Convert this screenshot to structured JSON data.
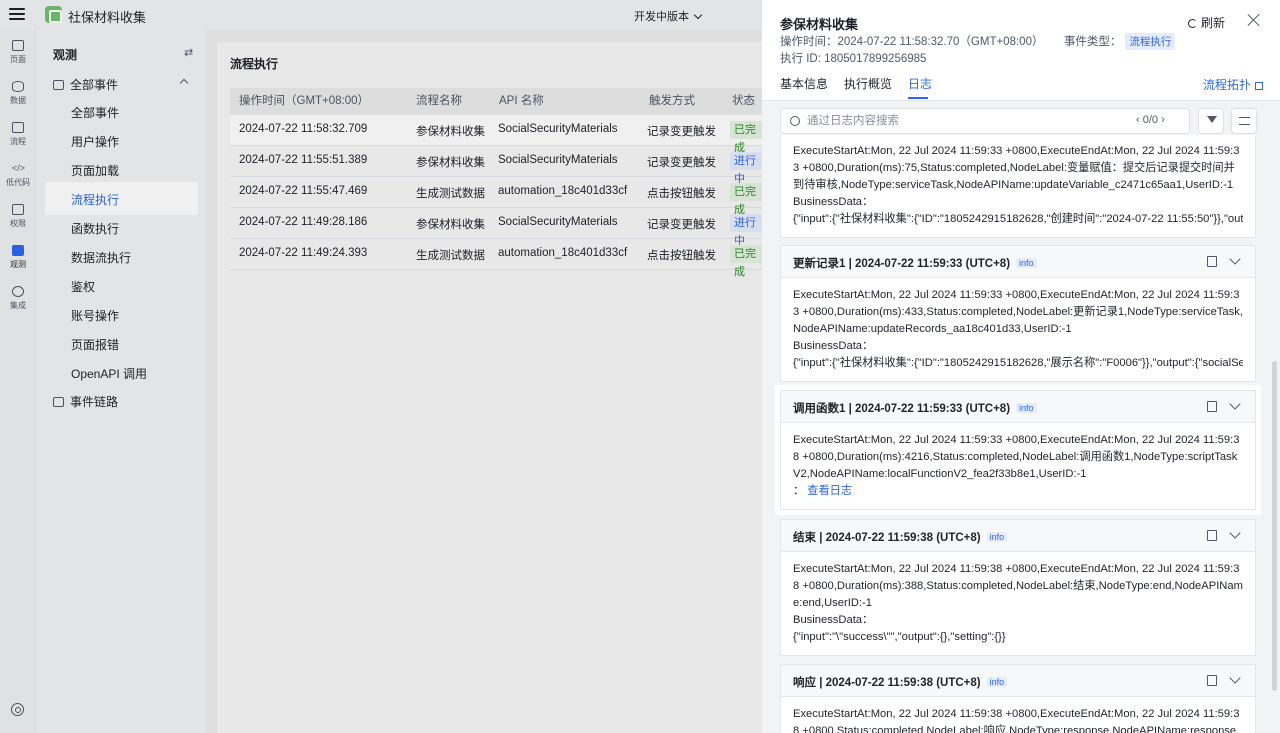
{
  "topbar": {
    "app_title": "社保材料收集",
    "version": "开发中版本"
  },
  "iconbar": {
    "items": [
      {
        "label": "页面",
        "icon": "page-icon"
      },
      {
        "label": "数据",
        "icon": "database-icon"
      },
      {
        "label": "流程",
        "icon": "flow-icon"
      },
      {
        "label": "低代码",
        "icon": "code-icon"
      },
      {
        "label": "权限",
        "icon": "lock-icon"
      },
      {
        "label": "观测",
        "icon": "observe-icon",
        "active": true
      },
      {
        "label": "集成",
        "icon": "integration-icon"
      }
    ]
  },
  "sidebar": {
    "heading": "观测",
    "swap": "⇄",
    "group_all": "全部事件",
    "items": [
      "全部事件",
      "用户操作",
      "页面加载",
      "流程执行",
      "函数执行",
      "数据流执行",
      "鉴权",
      "账号操作",
      "页面报错",
      "OpenAPI 调用"
    ],
    "group_chain": "事件链路"
  },
  "main": {
    "title": "流程执行",
    "columns": [
      "操作时间（GMT+08:00）",
      "流程名称",
      "API 名称",
      "触发方式",
      "状态"
    ],
    "rows": [
      {
        "time": "2024-07-22 11:58:32.709",
        "name": "参保材料收集",
        "api": "SocialSecurityMaterials",
        "trigger": "记录变更触发",
        "status": "已完成",
        "state": "done"
      },
      {
        "time": "2024-07-22 11:55:51.389",
        "name": "参保材料收集",
        "api": "SocialSecurityMaterials",
        "trigger": "记录变更触发",
        "status": "进行中",
        "state": "run"
      },
      {
        "time": "2024-07-22 11:55:47.469",
        "name": "生成测试数据",
        "api": "automation_18c401d33cf",
        "trigger": "点击按钮触发",
        "status": "已完成",
        "state": "done"
      },
      {
        "time": "2024-07-22 11:49:28.186",
        "name": "参保材料收集",
        "api": "SocialSecurityMaterials",
        "trigger": "记录变更触发",
        "status": "进行中",
        "state": "run"
      },
      {
        "time": "2024-07-22 11:49:24.393",
        "name": "生成测试数据",
        "api": "automation_18c401d33cf",
        "trigger": "点击按钮触发",
        "status": "已完成",
        "state": "done"
      }
    ]
  },
  "panel": {
    "title": "参保材料收集",
    "refresh": "刷新",
    "op_time_label": "操作时间：",
    "op_time": "2024-07-22 11:58:32.70（GMT+08:00）",
    "event_type_label": "事件类型：",
    "event_type": "流程执行",
    "exec_id_label": "执行 ID: ",
    "exec_id": "1805017899256985",
    "tabs": [
      "基本信息",
      "执行概览",
      "日志"
    ],
    "topo": "流程拓扑",
    "search_placeholder": "通过日志内容搜索",
    "search_page": "0/0",
    "logs": [
      {
        "body": [
          "ExecuteStartAt:Mon, 22 Jul 2024 11:59:33 +0800,ExecuteEndAt:Mon, 22 Jul 2024 11:59:33 +0800,Duration(ms):75,Status:completed,NodeLabel:变量赋值：提交后记录提交时间并到待审核,NodeType:serviceTask,NodeAPIName:updateVariable_c2471c65aa1,UserID:-1",
          "BusinessData：",
          "{\"input\":{\"社保材料收集\":{\"ID\":\"1805242915182628,\"创建时间\":\"2024-07-22 11:55:50\"}},\"out..."
        ]
      },
      {
        "title": "更新记录1 | 2024-07-22 11:59:33 (UTC+8)",
        "level": "info",
        "body": [
          "ExecuteStartAt:Mon, 22 Jul 2024 11:59:33 +0800,ExecuteEndAt:Mon, 22 Jul 2024 11:59:33 +0800,Duration(ms):433,Status:completed,NodeLabel:更新记录1,NodeType:serviceTask,NodeAPIName:updateRecords_aa18c401d33,UserID:-1",
          "BusinessData：",
          "{\"input\":{\"社保材料收集\":{\"ID\":\"1805242915182628,\"展示名称\":\"F0006\"}},\"output\":{\"socialSe..."
        ]
      },
      {
        "title": "调用函数1 | 2024-07-22 11:59:33 (UTC+8)",
        "level": "info",
        "body": [
          "ExecuteStartAt:Mon, 22 Jul 2024 11:59:33 +0800,ExecuteEndAt:Mon, 22 Jul 2024 11:59:38 +0800,Duration(ms):4216,Status:completed,NodeLabel:调用函数1,NodeType:scriptTaskV2,NodeAPIName:localFunctionV2_fea2f33b8e1,UserID:-1"
        ],
        "link_prefix": "： ",
        "link": "查看日志"
      },
      {
        "title": "结束 | 2024-07-22 11:59:38 (UTC+8)",
        "level": "info",
        "body": [
          "ExecuteStartAt:Mon, 22 Jul 2024 11:59:38 +0800,ExecuteEndAt:Mon, 22 Jul 2024 11:59:38 +0800,Duration(ms):388,Status:completed,NodeLabel:结束,NodeType:end,NodeAPIName:end,UserID:-1",
          "BusinessData：",
          "{\"input\":\"\\\"success\\\"\",\"output\":{},\"setting\":{}}"
        ]
      },
      {
        "title": "响应 | 2024-07-22 11:59:38 (UTC+8)",
        "level": "info",
        "body": [
          "ExecuteStartAt:Mon, 22 Jul 2024 11:59:38 +0800,ExecuteEndAt:Mon, 22 Jul 2024 11:59:38 +0800,Status:completed,NodeLabel:响应,NodeType:response,NodeAPIName:response,UserID:"
        ]
      }
    ]
  },
  "colors": {
    "accent": "#2d66f4",
    "done_bg": "#e3f3e1",
    "done_fg": "#2e8a2b",
    "run_bg": "#e5ecfd"
  }
}
